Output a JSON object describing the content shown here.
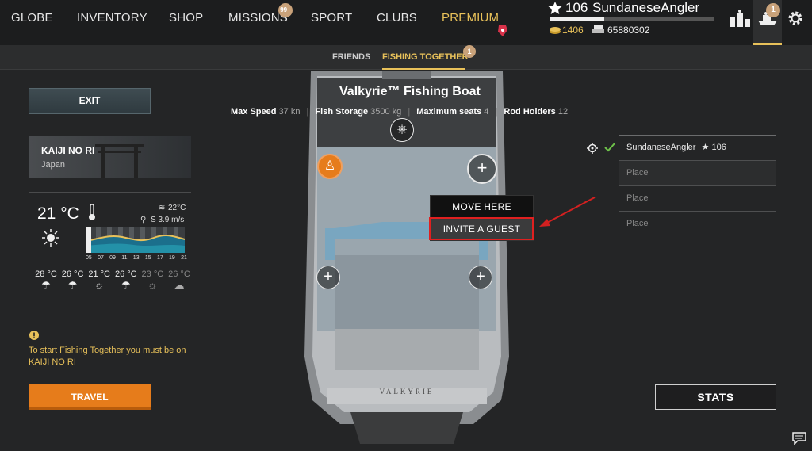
{
  "nav": {
    "items": [
      "GLOBE",
      "INVENTORY",
      "SHOP",
      "MISSIONS",
      "SPORT",
      "CLUBS",
      "PREMIUM"
    ],
    "missions_badge": "99+"
  },
  "player": {
    "level": "106",
    "name": "SundaneseAngler",
    "gold": "1406",
    "silver": "65880302",
    "xp_progress": 0.33
  },
  "notif_badge": "1",
  "subtabs": {
    "friends": "FRIENDS",
    "fishing_together": "FISHING TOGETHER",
    "fishing_badge": "1"
  },
  "left": {
    "exit_label": "EXIT",
    "location_name": "KAIJI NO RI",
    "location_country": "Japan",
    "temp_now": "21 °C",
    "water_temp": "22°C",
    "wind": "S 3.9 m/s",
    "hours": [
      "05",
      "07",
      "09",
      "11",
      "13",
      "15",
      "17",
      "19",
      "21"
    ],
    "forecast": [
      {
        "temp": "28 °C",
        "icon": "rain-icon"
      },
      {
        "temp": "26 °C",
        "icon": "rain-icon"
      },
      {
        "temp": "21 °C",
        "icon": "sun-icon"
      },
      {
        "temp": "26 °C",
        "icon": "rain-icon"
      },
      {
        "temp": "23 °C",
        "icon": "sun-icon"
      },
      {
        "temp": "26 °C",
        "icon": "partly-cloudy-icon"
      }
    ],
    "warning": "To start Fishing Together you must be on KAIJI NO RI",
    "travel_label": "TRAVEL"
  },
  "boat": {
    "title": "Valkyrie™ Fishing Boat",
    "specs": [
      {
        "label": "Max Speed",
        "value": "37 kn"
      },
      {
        "label": "Fish Storage",
        "value": "3500 kg"
      },
      {
        "label": "Maximum seats",
        "value": "4"
      },
      {
        "label": "Rod Holders",
        "value": "12"
      }
    ],
    "hull_text": "VALKYRIE"
  },
  "context_menu": {
    "move_here": "MOVE HERE",
    "invite_guest": "INVITE A GUEST"
  },
  "seats": {
    "owner_name": "SundaneseAngler",
    "owner_level": "106",
    "placeholders": [
      "Place",
      "Place",
      "Place"
    ]
  },
  "stats_label": "STATS",
  "colors": {
    "accent_gold": "#e8c15a",
    "travel_orange": "#e67c1b",
    "highlight_red": "#e02020"
  }
}
